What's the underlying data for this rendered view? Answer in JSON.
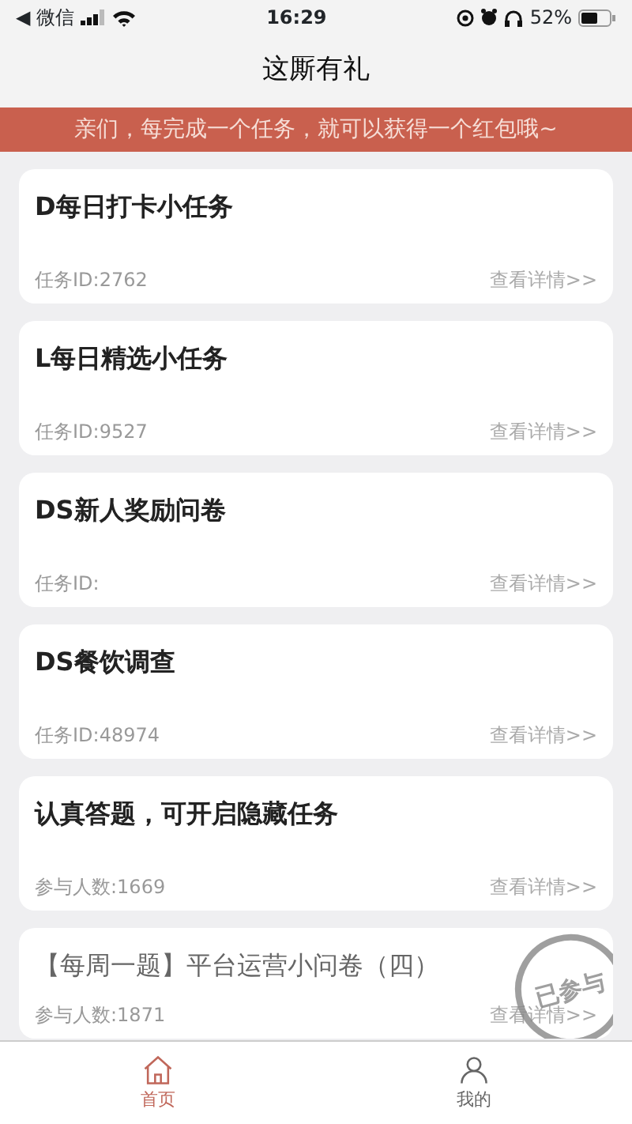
{
  "status_bar": {
    "back_label": "◀ 微信",
    "time": "16:29",
    "battery": "52%"
  },
  "title": "这厮有礼",
  "banner": "亲们，每完成一个任务，就可以获得一个红包哦~",
  "tasks": [
    {
      "title": "D每日打卡小任务",
      "meta": "任务ID:2762",
      "link": "查看详情>>",
      "participated": false
    },
    {
      "title": "L每日精选小任务",
      "meta": "任务ID:9527",
      "link": "查看详情>>",
      "participated": false
    },
    {
      "title": "DS新人奖励问卷",
      "meta": "任务ID:",
      "link": "查看详情>>",
      "participated": false
    },
    {
      "title": "DS餐饮调查",
      "meta": "任务ID:48974",
      "link": "查看详情>>",
      "participated": false
    },
    {
      "title": "认真答题，可开启隐藏任务",
      "meta": "参与人数:1669",
      "link": "查看详情>>",
      "participated": false
    },
    {
      "title": "【每周一题】平台运营小问卷（四）",
      "meta": "参与人数:1871",
      "link": "查看详情>>",
      "participated": true,
      "stamp": "已参与"
    }
  ],
  "tab_bar": [
    {
      "label": "首页",
      "kind": "home",
      "selected": true
    },
    {
      "label": "我的",
      "kind": "profile",
      "selected": false
    }
  ]
}
